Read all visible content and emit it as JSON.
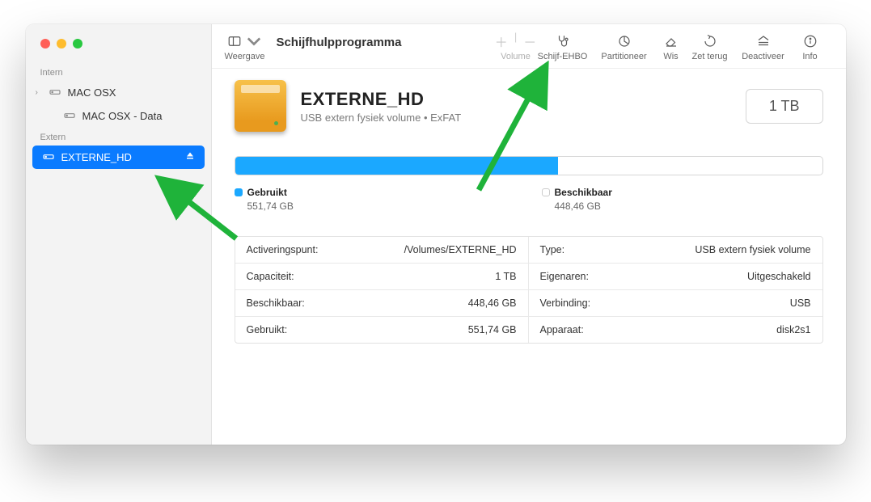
{
  "app_title": "Schijfhulpprogramma",
  "toolbar": {
    "view_label": "Weergave",
    "volume_label": "Volume",
    "first_aid_label": "Schijf-EHBO",
    "partition_label": "Partitioneer",
    "erase_label": "Wis",
    "restore_label": "Zet terug",
    "unmount_label": "Deactiveer",
    "info_label": "Info"
  },
  "sidebar": {
    "internal_label": "Intern",
    "external_label": "Extern",
    "items": [
      {
        "name": "MAC OSX"
      },
      {
        "name": "MAC OSX - Data"
      },
      {
        "name": "EXTERNE_HD"
      }
    ]
  },
  "volume": {
    "name": "EXTERNE_HD",
    "subtitle": "USB extern fysiek volume • ExFAT",
    "capacity": "1 TB",
    "usage_percent": 55,
    "used_label": "Gebruikt",
    "used_value": "551,74 GB",
    "free_label": "Beschikbaar",
    "free_value": "448,46 GB"
  },
  "details": {
    "left": [
      {
        "k": "Activeringspunt:",
        "v": "/Volumes/EXTERNE_HD"
      },
      {
        "k": "Capaciteit:",
        "v": "1 TB"
      },
      {
        "k": "Beschikbaar:",
        "v": "448,46 GB"
      },
      {
        "k": "Gebruikt:",
        "v": "551,74 GB"
      }
    ],
    "right": [
      {
        "k": "Type:",
        "v": "USB extern fysiek volume"
      },
      {
        "k": "Eigenaren:",
        "v": "Uitgeschakeld"
      },
      {
        "k": "Verbinding:",
        "v": "USB"
      },
      {
        "k": "Apparaat:",
        "v": "disk2s1"
      }
    ]
  }
}
